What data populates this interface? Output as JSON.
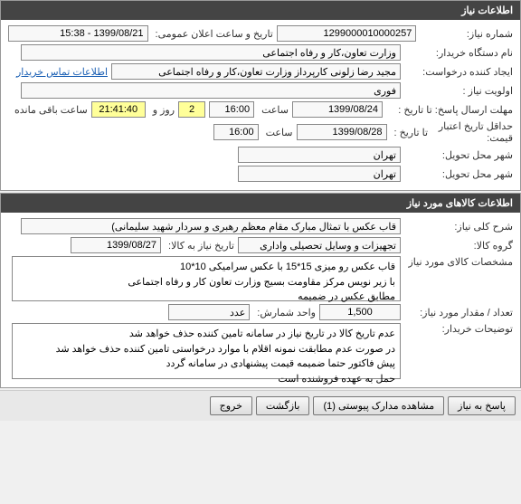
{
  "panels": {
    "need_info": {
      "title": "اطلاعات نیاز",
      "fields": {
        "need_no_label": "شماره نیاز:",
        "need_no": "1299000010000257",
        "announce_label": "تاریخ و ساعت اعلان عمومی:",
        "announce": "1399/08/21 - 15:38",
        "buyer_org_label": "نام دستگاه خریدار:",
        "buyer_org": "وزارت تعاون،کار و رفاه اجتماعی",
        "requester_label": "ایجاد کننده درخواست:",
        "requester": "مجید رضا زلونی کارپرداز وزارت تعاون،کار و رفاه اجتماعی",
        "contact_link": "اطلاعات تماس خریدار",
        "priority_label": "اولویت نیاز :",
        "priority": "فوری",
        "deadline_label": "مهلت ارسال پاسخ:  تا تاریخ :",
        "deadline_date": "1399/08/24",
        "time_label": "ساعت",
        "deadline_time": "16:00",
        "remaining_days": "2",
        "remaining_days_label": "روز و",
        "remaining_time": "21:41:40",
        "remaining_suffix": "ساعت باقی مانده",
        "validity_label": "حداقل تاریخ اعتبار\nقیمت:",
        "validity_label2": "تا تاریخ :",
        "validity_date": "1399/08/28",
        "validity_time": "16:00",
        "delivery_city_label": "شهر محل تحویل:",
        "delivery_city": "تهران",
        "delivery_city2_label": "شهر محل تحویل:",
        "delivery_city2": "تهران"
      }
    },
    "goods_info": {
      "title": "اطلاعات کالاهای مورد نیاز",
      "fields": {
        "desc_label": "شرح کلی نیاز:",
        "desc": "قاب عکس با تمثال مبارک مقام معظم رهبری و سردار شهید سلیمانی)",
        "group_label": "گروه کالا:",
        "group": "تجهیزات و وسایل تحصیلی واداری",
        "need_date_label": "تاریخ نیاز به کالا:",
        "need_date": "1399/08/27",
        "spec_label": "مشخصات کالای مورد نیاز",
        "spec": "قاب عکس رو میزی 15*15 با عکس سرامیکی 10*10\nبا زیر نویس مرکز مقاومت بسیج وزارت تعاون کار و رفاه اجتماعی\nمطابق عکس در ضمیمه",
        "qty_label": "تعداد / مقدار مورد نیاز:",
        "qty": "1,500",
        "unit_label": "واحد شمارش:",
        "unit": "عدد",
        "notes_label": "توضیحات خریدار:",
        "notes": "عدم تاریخ کالا در تاریخ نیاز در سامانه تامین کننده حذف خواهد شد\nدر صورت عدم مطابقت نمونه اقلام با موارد درخواستی تامین کننده حذف خواهد شد\nپیش فاکتور حتما ضمیمه قیمت پیشنهادی در سامانه گردد\nحمل به عهده فروشنده است"
      }
    }
  },
  "buttons": {
    "reply": "پاسخ به نیاز",
    "view_docs": "مشاهده مدارک پیوستی (1)",
    "back": "بازگشت",
    "exit": "خروج"
  }
}
